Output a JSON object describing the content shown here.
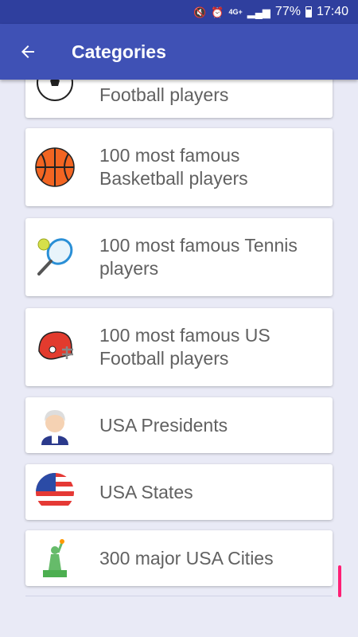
{
  "status_bar": {
    "network": "4G+",
    "battery": "77%",
    "time": "17:40"
  },
  "app_bar": {
    "title": "Categories",
    "back_icon": "arrow-left-icon"
  },
  "categories": [
    {
      "label": "Football players",
      "icon": "football-icon"
    },
    {
      "label": "100 most famous Basketball players",
      "icon": "basketball-icon"
    },
    {
      "label": "100 most famous Tennis players",
      "icon": "tennis-racket-icon"
    },
    {
      "label": "100 most famous US Football players",
      "icon": "football-helmet-icon"
    },
    {
      "label": "USA Presidents",
      "icon": "president-icon"
    },
    {
      "label": "USA States",
      "icon": "us-flag-icon"
    },
    {
      "label": "300 major USA Cities",
      "icon": "statue-of-liberty-icon"
    }
  ],
  "colors": {
    "app_bar": "#3f51b5",
    "status_bar": "#2f3f9e",
    "background": "#e9eaf6",
    "scroll_indicator": "#ff1f75"
  }
}
